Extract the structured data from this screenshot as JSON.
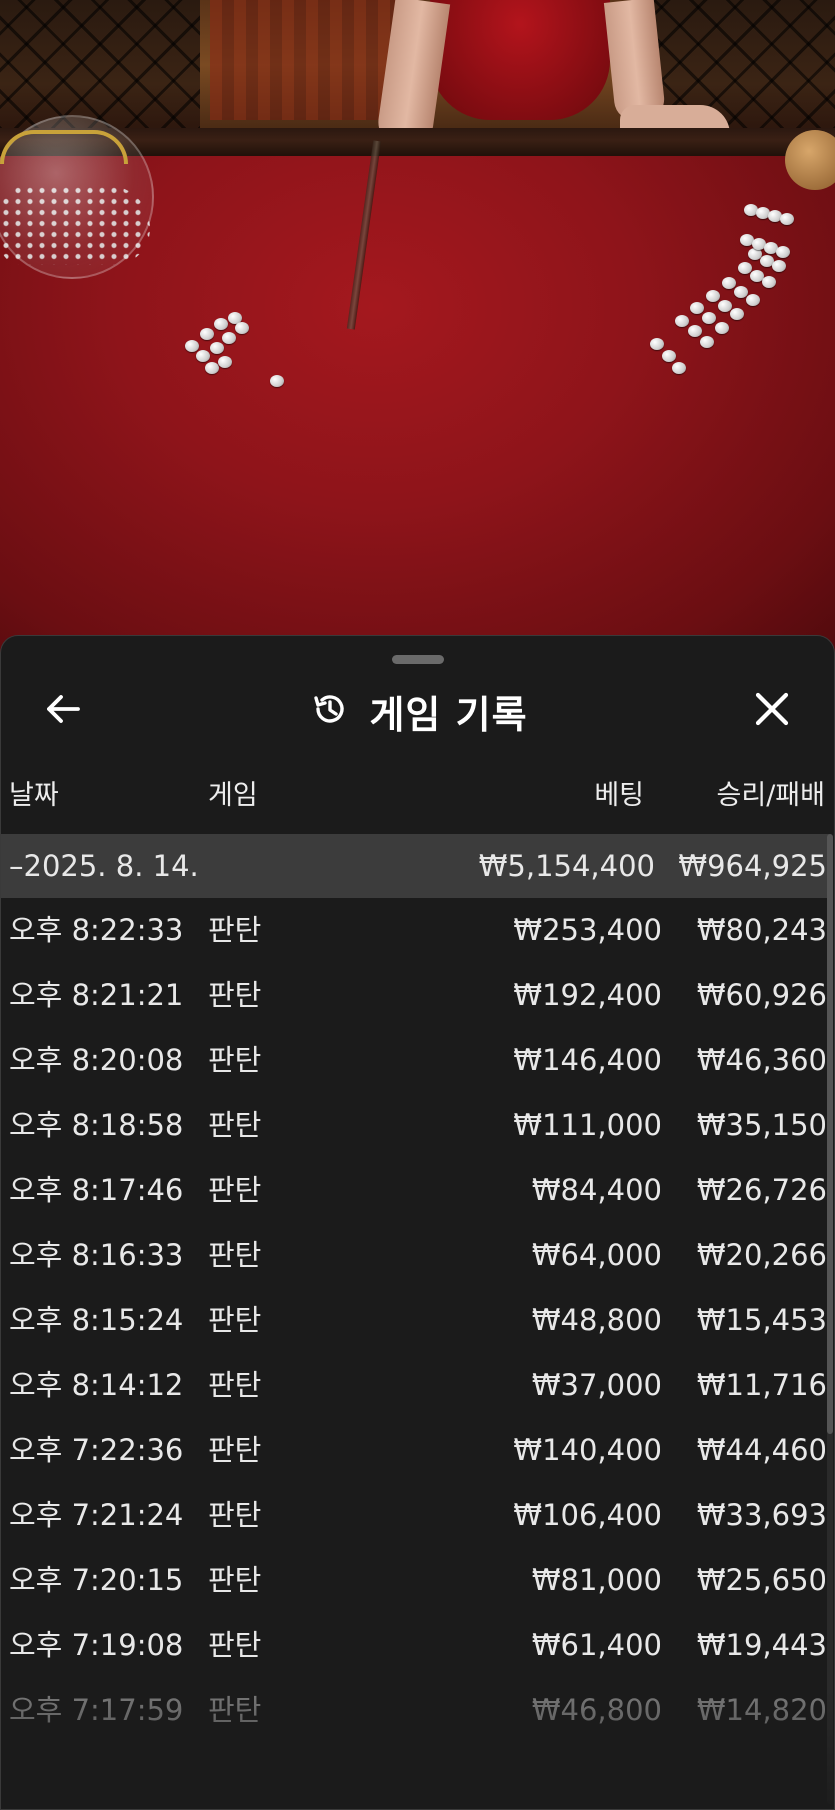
{
  "header": {
    "title": "게임 기록",
    "back_icon": "arrow-left-icon",
    "history_icon": "history-clock-icon",
    "close_icon": "close-icon"
  },
  "columns": {
    "date": "날짜",
    "game": "게임",
    "bet": "베팅",
    "win_loss": "승리/패배"
  },
  "group": {
    "date": "–2025. 8. 14.",
    "bet_total": "₩5,154,400",
    "win_total": "₩964,925"
  },
  "rows": [
    {
      "time": "오후 8:22:33",
      "game": "판탄",
      "bet": "₩253,400",
      "win": "₩80,243"
    },
    {
      "time": "오후 8:21:21",
      "game": "판탄",
      "bet": "₩192,400",
      "win": "₩60,926"
    },
    {
      "time": "오후 8:20:08",
      "game": "판탄",
      "bet": "₩146,400",
      "win": "₩46,360"
    },
    {
      "time": "오후 8:18:58",
      "game": "판탄",
      "bet": "₩111,000",
      "win": "₩35,150"
    },
    {
      "time": "오후 8:17:46",
      "game": "판탄",
      "bet": "₩84,400",
      "win": "₩26,726"
    },
    {
      "time": "오후 8:16:33",
      "game": "판탄",
      "bet": "₩64,000",
      "win": "₩20,266"
    },
    {
      "time": "오후 8:15:24",
      "game": "판탄",
      "bet": "₩48,800",
      "win": "₩15,453"
    },
    {
      "time": "오후 8:14:12",
      "game": "판탄",
      "bet": "₩37,000",
      "win": "₩11,716"
    },
    {
      "time": "오후 7:22:36",
      "game": "판탄",
      "bet": "₩140,400",
      "win": "₩44,460"
    },
    {
      "time": "오후 7:21:24",
      "game": "판탄",
      "bet": "₩106,400",
      "win": "₩33,693"
    },
    {
      "time": "오후 7:20:15",
      "game": "판탄",
      "bet": "₩81,000",
      "win": "₩25,650"
    },
    {
      "time": "오후 7:19:08",
      "game": "판탄",
      "bet": "₩61,400",
      "win": "₩19,443"
    },
    {
      "time": "오후 7:17:59",
      "game": "판탄",
      "bet": "₩46,800",
      "win": "₩14,820"
    }
  ],
  "colors": {
    "sheet_bg": "#1b1b1b",
    "group_bg": "#3c3c3c",
    "felt": "#8e141a",
    "text": "#e8e8e8"
  }
}
